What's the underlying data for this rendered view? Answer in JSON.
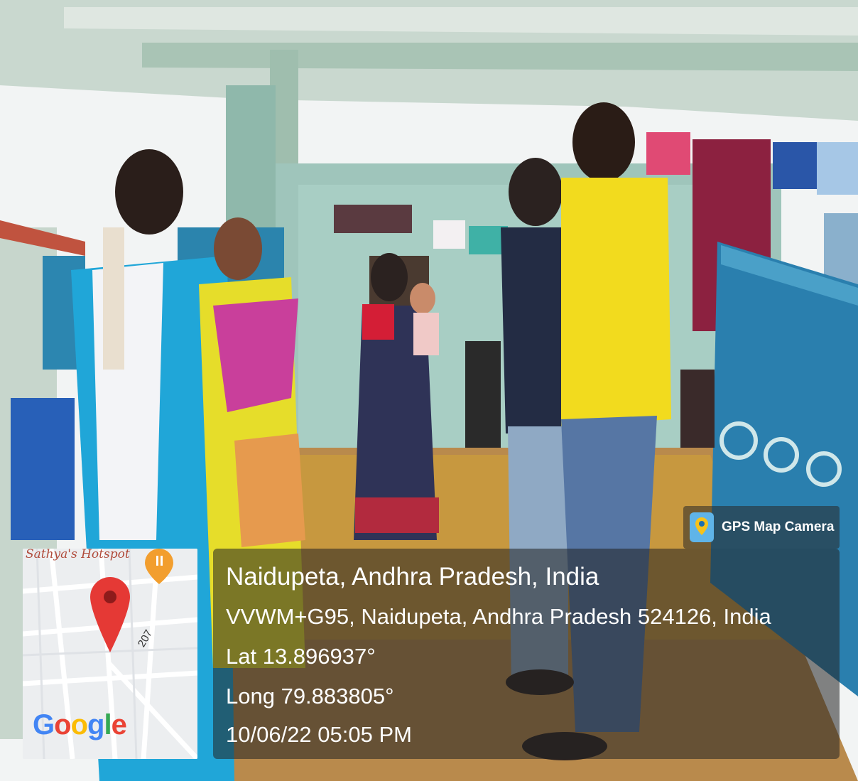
{
  "badge": {
    "app_name": "GPS Map Camera"
  },
  "location": {
    "title": "Naidupeta, Andhra Pradesh, India",
    "address": "VVWM+G95, Naidupeta, Andhra Pradesh 524126, India",
    "lat": "Lat 13.896937°",
    "long": "Long 79.883805°",
    "datetime": "10/06/22 05:05 PM"
  },
  "map": {
    "place_label": "Sathya's Hotspot",
    "road_number": "207",
    "brand": "Google"
  }
}
